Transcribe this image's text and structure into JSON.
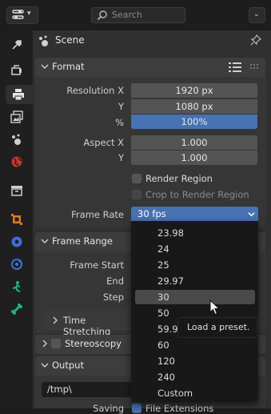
{
  "header": {
    "search_placeholder": "Search",
    "editor_icon": "properties-editor-icon",
    "options_icon": "chevron-down-icon"
  },
  "sidebar": {
    "tabs": [
      {
        "name": "tool",
        "icon": "tool-icon"
      },
      {
        "name": "render",
        "icon": "render-icon"
      },
      {
        "name": "output",
        "icon": "printer-icon",
        "active": true
      },
      {
        "name": "view-layer",
        "icon": "view-layer-icon"
      },
      {
        "name": "scene",
        "icon": "scene-icon"
      },
      {
        "name": "world",
        "icon": "world-icon"
      },
      {
        "name": "collection",
        "icon": "collection-icon"
      },
      {
        "name": "object",
        "icon": "object-icon"
      },
      {
        "name": "modifiers",
        "icon": "modifier-icon"
      },
      {
        "name": "physics",
        "icon": "physics-icon"
      },
      {
        "name": "constraints",
        "icon": "constraint-icon"
      },
      {
        "name": "data",
        "icon": "bone-icon"
      }
    ]
  },
  "breadcrumb": {
    "label": "Scene",
    "pin_icon": "pin-icon"
  },
  "format": {
    "title": "Format",
    "resolution_x_label": "Resolution X",
    "resolution_x_value": "1920 px",
    "y_label": "Y",
    "resolution_y_value": "1080 px",
    "percent_label": "%",
    "percent_value": "100%",
    "aspect_x_label": "Aspect X",
    "aspect_x_value": "1.000",
    "aspect_y_label": "Y",
    "aspect_y_value": "1.000",
    "render_region_label": "Render Region",
    "crop_label": "Crop to Render Region",
    "frame_rate_label": "Frame Rate",
    "frame_rate_value": "30 fps"
  },
  "frame_range": {
    "title": "Frame Range",
    "frame_start_label": "Frame Start",
    "end_label": "End",
    "step_label": "Step",
    "time_stretching_label": "Time Stretching"
  },
  "stereoscopy": {
    "title": "Stereoscopy"
  },
  "output": {
    "title": "Output",
    "path_value": "/tmp\\",
    "saving_label": "Saving",
    "file_extensions_label": "File Extensions"
  },
  "dropdown": {
    "options": [
      "23.98",
      "24",
      "25",
      "29.97",
      "30",
      "50",
      "59.94",
      "60",
      "120",
      "240",
      "Custom"
    ],
    "hovered": "30"
  },
  "tooltip": {
    "text": "Load a preset."
  },
  "colors": {
    "accent": "#4772b3",
    "panel": "#303030",
    "section": "#3d3d3d",
    "field": "#545454",
    "menu": "#181818"
  }
}
